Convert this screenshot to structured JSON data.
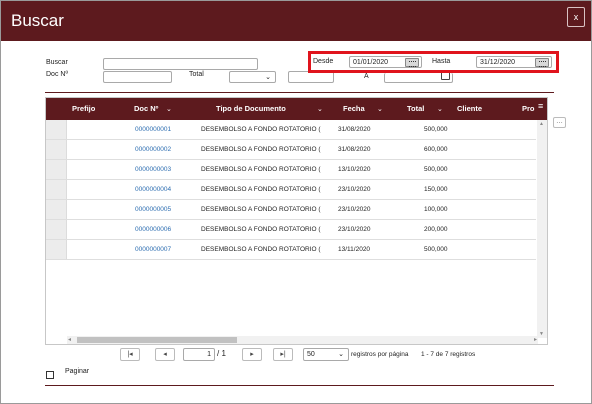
{
  "dialog": {
    "title": "Buscar",
    "close_label": "x"
  },
  "filters": {
    "buscar_label": "Buscar",
    "buscar_value": "",
    "doc_label": "Doc Nº",
    "doc_value": "",
    "total_label": "Total",
    "total_select_value": "",
    "total_value": "",
    "desde_label": "Desde",
    "desde_value": "01/01/2020",
    "hasta_label": "Hasta",
    "hasta_value": "31/12/2020",
    "a_label": "A"
  },
  "grid": {
    "columns": [
      "Prefijo",
      "Doc Nº",
      "Tipo de Documento",
      "Fecha",
      "Total",
      "Cliente",
      "Pro"
    ],
    "rows": [
      {
        "prefijo": "",
        "doc": "0000000001",
        "tipo": "DESEMBOLSO A FONDO ROTATORIO (",
        "fecha": "31/08/2020",
        "total": "500,000"
      },
      {
        "prefijo": "",
        "doc": "0000000002",
        "tipo": "DESEMBOLSO A FONDO ROTATORIO (",
        "fecha": "31/08/2020",
        "total": "600,000"
      },
      {
        "prefijo": "",
        "doc": "0000000003",
        "tipo": "DESEMBOLSO A FONDO ROTATORIO (",
        "fecha": "13/10/2020",
        "total": "500,000"
      },
      {
        "prefijo": "",
        "doc": "0000000004",
        "tipo": "DESEMBOLSO A FONDO ROTATORIO (",
        "fecha": "23/10/2020",
        "total": "150,000"
      },
      {
        "prefijo": "",
        "doc": "0000000005",
        "tipo": "DESEMBOLSO A FONDO ROTATORIO (",
        "fecha": "23/10/2020",
        "total": "100,000"
      },
      {
        "prefijo": "",
        "doc": "0000000006",
        "tipo": "DESEMBOLSO A FONDO ROTATORIO (",
        "fecha": "23/10/2020",
        "total": "200,000"
      },
      {
        "prefijo": "",
        "doc": "0000000007",
        "tipo": "DESEMBOLSO A FONDO ROTATORIO (",
        "fecha": "13/11/2020",
        "total": "500,000"
      }
    ]
  },
  "pager": {
    "page_value": "1",
    "of_text": "/ 1",
    "page_size": "50",
    "per_page_label": "registros por página",
    "range_text": "1 - 7 de 7 registros"
  },
  "footer": {
    "paginar_label": "Paginar"
  },
  "colors": {
    "brand": "#5d1a1e",
    "highlight": "#e0141d",
    "link": "#2b6cb0"
  }
}
